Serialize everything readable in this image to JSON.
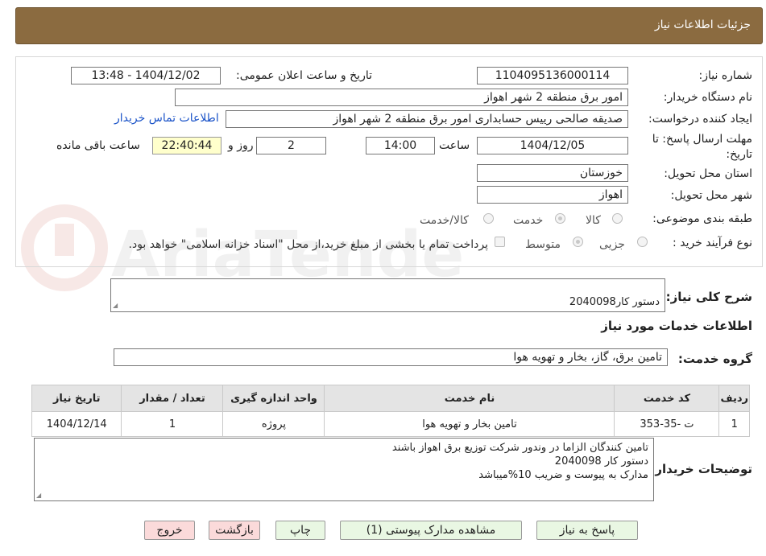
{
  "header": {
    "title": "جزئیات اطلاعات نیاز"
  },
  "form": {
    "need_number_label": "شماره نیاز:",
    "need_number": "1104095136000114",
    "announce_label": "تاریخ و ساعت اعلان عمومی:",
    "announce_value": "1404/12/02 - 13:48",
    "buyer_org_label": "نام دستگاه خریدار:",
    "buyer_org": "امور برق منطقه 2 شهر اهواز",
    "creator_label": "ایجاد کننده درخواست:",
    "creator": "صدیقه صالحی رییس حسابداری امور برق منطقه 2 شهر اهواز",
    "contact_link": "اطلاعات تماس خریدار",
    "deadline_label_1": "مهلت ارسال پاسخ: تا",
    "deadline_label_2": "تاریخ:",
    "deadline_date": "1404/12/05",
    "hour_label": "ساعت",
    "deadline_time": "14:00",
    "days_value": "2",
    "days_label": "روز و",
    "remaining_time": "22:40:44",
    "remaining_label": "ساعت باقی مانده",
    "province_label": "استان محل تحویل:",
    "province": "خوزستان",
    "city_label": "شهر محل تحویل:",
    "city": "اهواز",
    "category_label": "طبقه بندی موضوعی:",
    "category_options": [
      "کالا",
      "خدمت",
      "کالا/خدمت"
    ],
    "purchase_type_label": "نوع فرآیند خرید :",
    "purchase_options": [
      "جزیی",
      "متوسط"
    ],
    "payment_note": "پرداخت تمام یا بخشی از مبلغ خرید،از محل \"اسناد خزانه اسلامی\" خواهد بود."
  },
  "summary": {
    "label": "شرح کلی نیاز:",
    "value": "دستور کار2040098"
  },
  "services": {
    "section_title": "اطلاعات خدمات مورد نیاز",
    "group_label": "گروه خدمت:",
    "group_value": "تامین برق، گاز، بخار و تهویه هوا",
    "columns": [
      "ردیف",
      "کد خدمت",
      "نام خدمت",
      "واحد اندازه گیری",
      "تعداد / مقدار",
      "تاریخ نیاز"
    ],
    "rows": [
      [
        "1",
        "ت -35-353",
        "تامین بخار و تهویه هوا",
        "پروژه",
        "1",
        "1404/12/14"
      ]
    ]
  },
  "buyer_notes": {
    "label": "توضیحات خریدار:",
    "value": "تامین کنندگان الزاما در وندور شرکت توزیع برق اهواز باشند\nدستور کار 2040098\nمدارک به پیوست و ضریب 10%میباشد"
  },
  "buttons": {
    "reply": "پاسخ به نیاز",
    "attachments": "مشاهده مدارک پیوستی (1)",
    "print": "چاپ",
    "back": "بازگشت",
    "exit": "خروج"
  },
  "watermark": {
    "text": "AriaTender.neT"
  },
  "colors": {
    "header_bg": "#8b6b40",
    "button_green": "#e9f7e3",
    "button_red": "#fbdada",
    "time_bg": "#ffffcc",
    "link": "#1a53c8"
  }
}
